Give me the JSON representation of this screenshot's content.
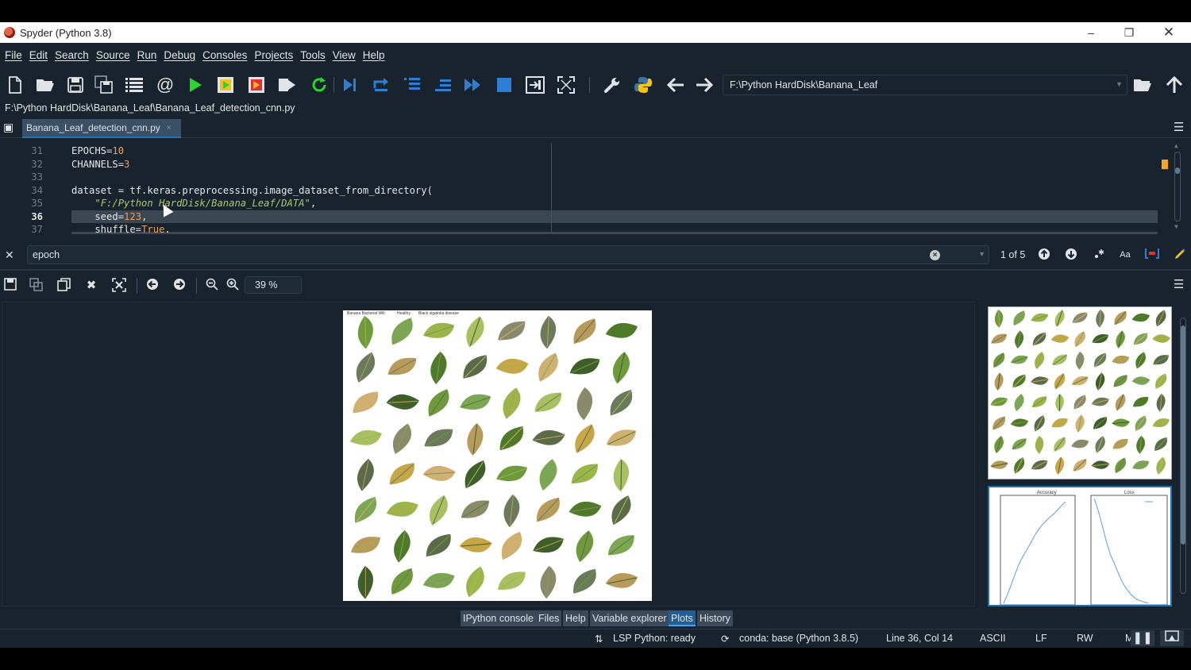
{
  "window": {
    "title": "Spyder (Python 3.8)",
    "controls": [
      "minimize-icon",
      "restore-icon",
      "close-icon"
    ]
  },
  "menu": [
    "File",
    "Edit",
    "Search",
    "Source",
    "Run",
    "Debug",
    "Consoles",
    "Projects",
    "Tools",
    "View",
    "Help"
  ],
  "toolbar": {
    "icons": [
      "new-file-icon",
      "open-file-icon",
      "save-icon",
      "save-all-icon",
      "outline-icon",
      "email-icon",
      "run-icon",
      "run-cell-icon",
      "run-cell-advance-icon",
      "run-selection-icon",
      "rerun-icon",
      "debug-icon",
      "step-icon",
      "step-into-icon",
      "step-return-icon",
      "continue-icon",
      "stop-icon",
      "maximize-pane-icon",
      "fullscreen-icon",
      "preferences-icon",
      "python-path-icon",
      "back-arrow-icon",
      "forward-arrow-icon",
      "browse-dir-icon",
      "parent-dir-icon"
    ],
    "working_dir": "F:\\Python HardDisk\\Banana_Leaf"
  },
  "editor": {
    "file_path": "F:\\Python HardDisk\\Banana_Leaf\\Banana_Leaf_detection_cnn.py",
    "tab_label": "Banana_Leaf_detection_cnn.py",
    "tab_close": "×",
    "line_numbers": [
      "31",
      "32",
      "33",
      "34",
      "35",
      "36",
      "37"
    ],
    "current_line": "36",
    "code": {
      "l31_name": "EPOCHS",
      "l31_eq": "=",
      "l31_val": "10",
      "l32_name": "CHANNELS",
      "l32_eq": "=",
      "l32_val": "3",
      "l34_a": "dataset = tf.keras.preprocessing.image_dataset_from_directory(",
      "l35_str": "\"F:/Python HardDisk/Banana_Leaf/DATA\"",
      "l35_comma": ",",
      "l36_name": "    seed",
      "l36_eq": "=",
      "l36_val": "123",
      "l36_comma": ",",
      "l37_name": "    shuffle",
      "l37_eq": "=",
      "l37_val": "True",
      "l37_comma": "."
    }
  },
  "find": {
    "close": "✕",
    "query": "epoch",
    "match_count": "1 of 5"
  },
  "plots": {
    "zoom": "39 %",
    "main_figure_labels": [
      "Banana Bacterial Wilt",
      "Healthy",
      "Black sigatoka disease"
    ],
    "thumbnail_titles": [
      "Accuracy",
      "Loss"
    ]
  },
  "panel_tabs": [
    {
      "label": "IPython console",
      "active": false
    },
    {
      "label": "Files",
      "active": false
    },
    {
      "label": "Help",
      "active": false
    },
    {
      "label": "Variable explorer",
      "active": false
    },
    {
      "label": "Plots",
      "active": true
    },
    {
      "label": "History",
      "active": false
    }
  ],
  "status": {
    "lsp": "LSP Python: ready",
    "conda": "conda: base (Python 3.8.5)",
    "position": "Line 36, Col 14",
    "encoding": "ASCII",
    "eol": "LF",
    "permissions": "RW",
    "mem": "M"
  },
  "colors": {
    "background": "#19232d",
    "accent": "#1a72bb",
    "run_green": "#2bd42b",
    "number_orange": "#e8a060",
    "string_green": "#a7c96c"
  }
}
